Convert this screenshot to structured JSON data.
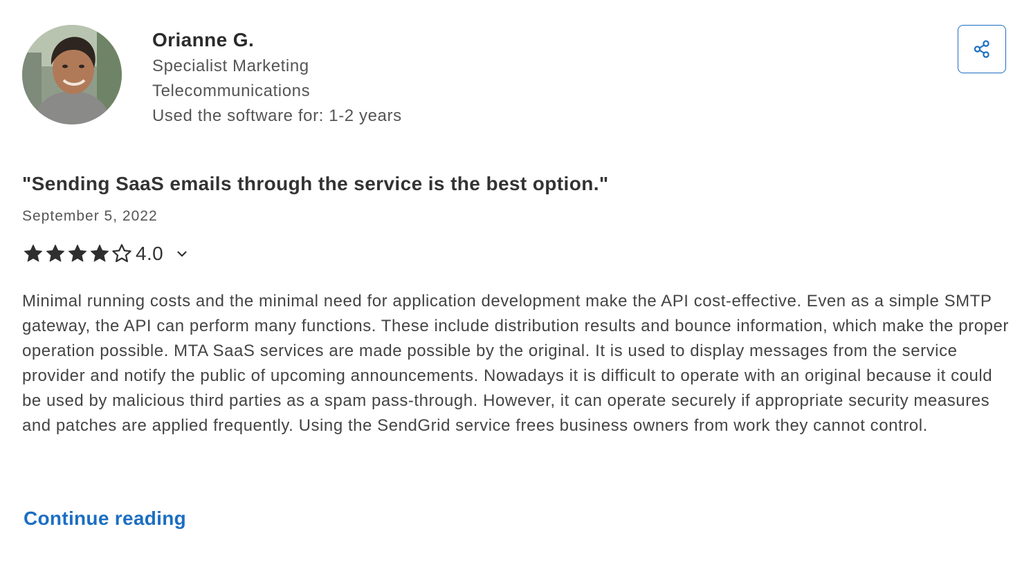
{
  "reviewer": {
    "name": "Orianne G.",
    "job_title": "Specialist Marketing",
    "industry": "Telecommunications",
    "usage": "Used the software for: 1-2 years",
    "avatar_icon": "user-photo"
  },
  "share": {
    "icon": "share-icon"
  },
  "review": {
    "title": "\"Sending SaaS emails through the service is the best option.\"",
    "date": "September 5, 2022",
    "rating": {
      "value": 4.0,
      "max": 5,
      "label": "4.0",
      "toggle_icon": "chevron-down-icon"
    },
    "body": "Minimal running costs and the minimal need for application development make the API cost-effective. Even as a simple SMTP gateway, the API can perform many functions. These include distribution results and bounce information, which make the proper operation possible. MTA SaaS services are made possible by the original. It is used to display messages from the service provider and notify the public of upcoming announcements. Nowadays it is difficult to operate with an original because it could be used by malicious third parties as a spam pass-through. However, it can operate securely if appropriate security measures and patches are applied frequently. Using the SendGrid service frees business owners from work they cannot control."
  },
  "actions": {
    "continue_label": "Continue reading"
  },
  "colors": {
    "accent": "#1b6ec2",
    "text": "#2b2b2b",
    "muted": "#555555",
    "star": "#2f2f2f"
  }
}
